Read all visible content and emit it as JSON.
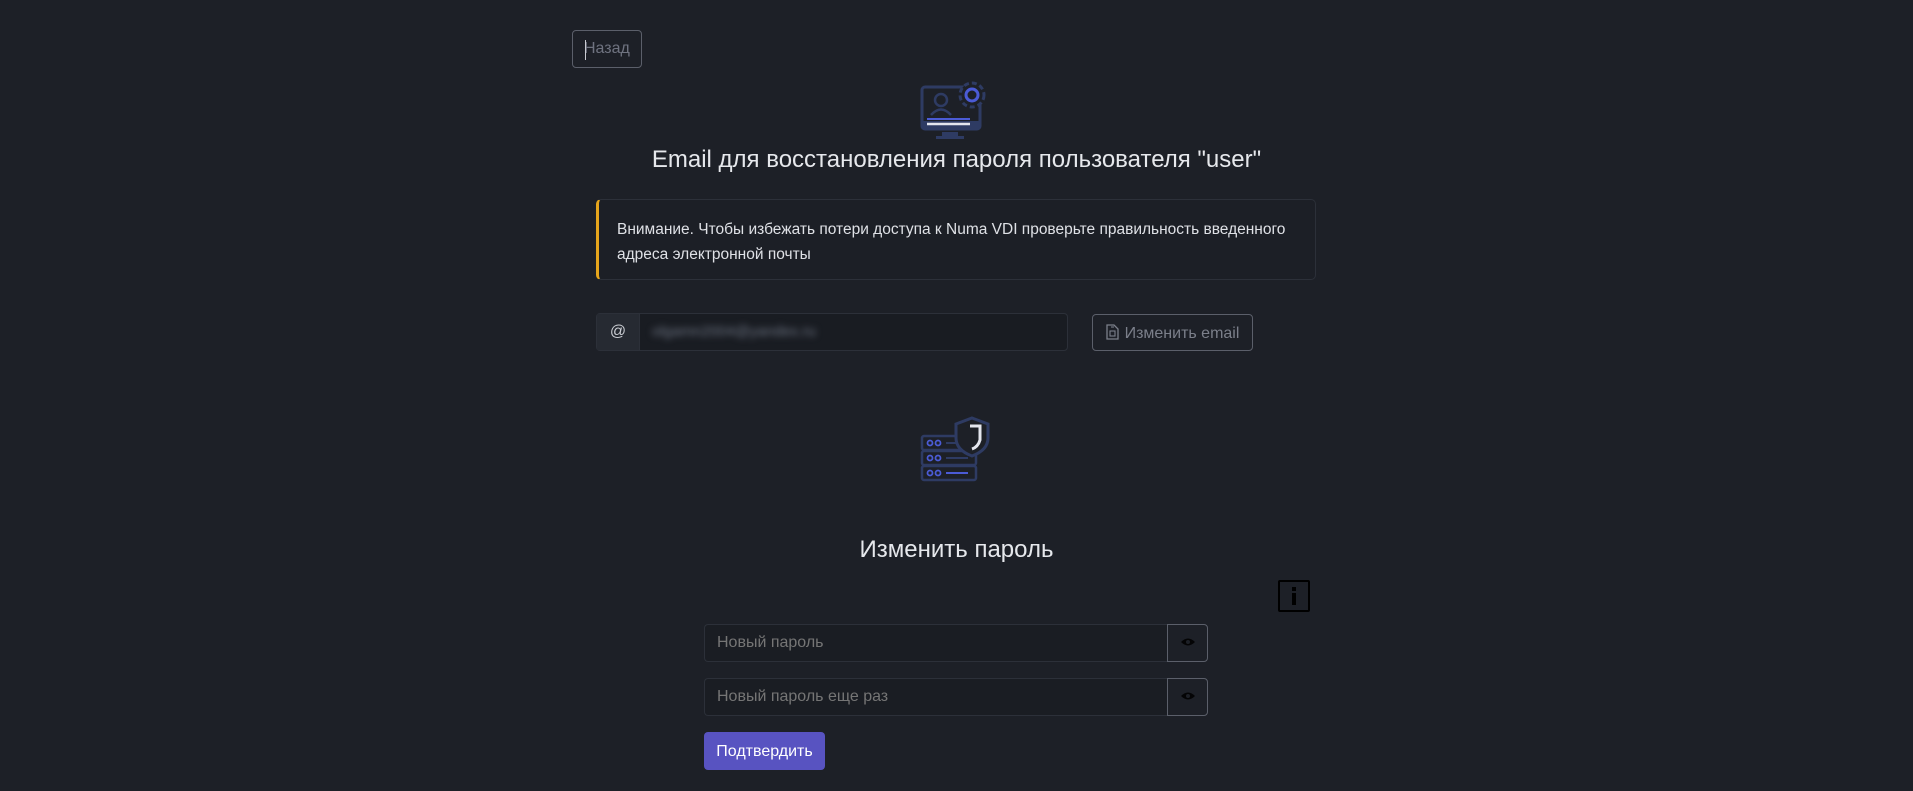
{
  "nav": {
    "back_label": "Назад"
  },
  "email_section": {
    "icon": "monitor-settings-icon",
    "title": "Email для восстановления пароля пользователя \"user\"",
    "alert_text": "Внимание. Чтобы избежать потери доступа к Numa VDI проверьте правильность введенного адреса электронной почты",
    "at_symbol": "@",
    "email_value": "olgamn2004@yandex.ru",
    "change_button_label": "Изменить email",
    "change_button_icon": "file-icon"
  },
  "password_section": {
    "icon": "server-shield-icon",
    "title": "Изменить пароль",
    "info_icon": "info-icon",
    "new_password_placeholder": "Новый пароль",
    "repeat_password_placeholder": "Новый пароль еще раз",
    "eye_icon": "eye-icon",
    "submit_label": "Подтвердить"
  },
  "colors": {
    "background": "#1d2027",
    "accent": "#5853c1",
    "warning": "#e6a51c",
    "illustration": "#2e3b63"
  }
}
